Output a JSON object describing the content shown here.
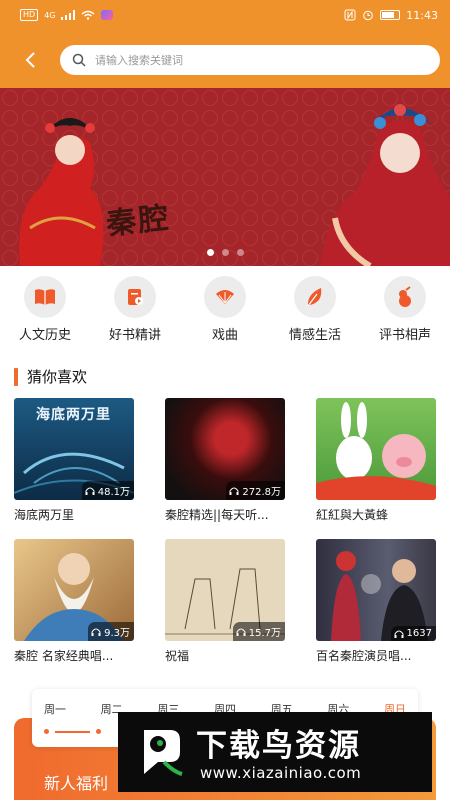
{
  "status_bar": {
    "hd": "HD",
    "network": "4G",
    "time": "11:43"
  },
  "search": {
    "placeholder": "请输入搜索关键词"
  },
  "banner": {
    "title": "秦腔",
    "indicator_active": 0
  },
  "categories": [
    {
      "label": "人文历史",
      "icon": "book-icon"
    },
    {
      "label": "好书精讲",
      "icon": "audiobook-icon"
    },
    {
      "label": "戏曲",
      "icon": "fan-icon"
    },
    {
      "label": "情感生活",
      "icon": "leaf-icon"
    },
    {
      "label": "评书相声",
      "icon": "gourd-icon"
    }
  ],
  "section": {
    "title": "猜你喜欢"
  },
  "items": [
    {
      "title": "海底两万里",
      "plays": "48.1万",
      "cover_text": "海底两万里"
    },
    {
      "title": "秦腔精选||每天听...",
      "plays": "272.8万"
    },
    {
      "title": "紅紅與大黃蜂",
      "plays": ""
    },
    {
      "title": "秦腔 名家经典唱...",
      "plays": "9.3万"
    },
    {
      "title": "祝福",
      "plays": "15.7万"
    },
    {
      "title": "百名秦腔演员唱...",
      "plays": "1637"
    }
  ],
  "weekdays": [
    "周一",
    "周二",
    "周三",
    "周四",
    "周五",
    "周六",
    "周日"
  ],
  "promo": {
    "text": "新人福利"
  },
  "watermark": {
    "title": "下载鸟资源",
    "url": "www.xiazainiao.com"
  },
  "colors": {
    "accent": "#f0922c",
    "orange": "#f06a2e"
  }
}
